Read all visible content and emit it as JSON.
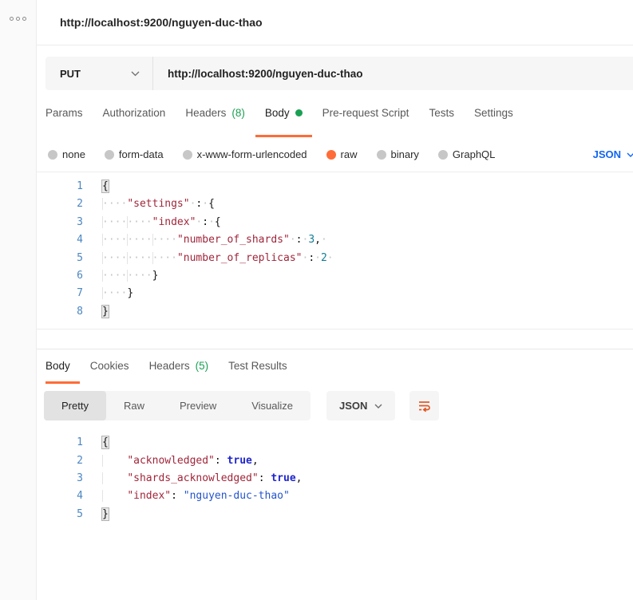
{
  "colors": {
    "accent_orange": "#ff6c37",
    "success_green": "#1aa053",
    "link_blue": "#1266f1",
    "key_maroon": "#a0263a",
    "number_teal": "#107d95",
    "atom_blue": "#2026cc",
    "string_blue": "#2454cc"
  },
  "tab_header": {
    "title": "http://localhost:9200/nguyen-duc-thao"
  },
  "request": {
    "method": "PUT",
    "url": "http://localhost:9200/nguyen-duc-thao",
    "tabs": [
      {
        "label": "Params"
      },
      {
        "label": "Authorization"
      },
      {
        "label": "Headers",
        "count": "(8)"
      },
      {
        "label": "Body",
        "active": true,
        "dot": true
      },
      {
        "label": "Pre-request Script"
      },
      {
        "label": "Tests"
      },
      {
        "label": "Settings"
      }
    ],
    "body_types": [
      {
        "label": "none"
      },
      {
        "label": "form-data"
      },
      {
        "label": "x-www-form-urlencoded"
      },
      {
        "label": "raw",
        "selected": true
      },
      {
        "label": "binary"
      },
      {
        "label": "GraphQL"
      }
    ],
    "language": "JSON",
    "editor": {
      "show_whitespace": true,
      "lines": [
        {
          "n": "1",
          "seg": [
            [
              "pun hl",
              "{"
            ]
          ]
        },
        {
          "n": "2",
          "seg": [
            [
              "ind",
              "    "
            ],
            [
              "key",
              "\"settings\""
            ],
            [
              "ws",
              " "
            ],
            [
              "pun",
              ":"
            ],
            [
              "ws",
              " "
            ],
            [
              "pun",
              "{"
            ]
          ]
        },
        {
          "n": "3",
          "seg": [
            [
              "ind",
              "        "
            ],
            [
              "key",
              "\"index\""
            ],
            [
              "ws",
              " "
            ],
            [
              "pun",
              ":"
            ],
            [
              "ws",
              " "
            ],
            [
              "pun",
              "{"
            ]
          ]
        },
        {
          "n": "4",
          "seg": [
            [
              "ind",
              "            "
            ],
            [
              "key",
              "\"number_of_shards\""
            ],
            [
              "ws",
              " "
            ],
            [
              "pun",
              ":"
            ],
            [
              "ws",
              " "
            ],
            [
              "num",
              "3"
            ],
            [
              "pun",
              ","
            ],
            [
              "ws",
              " "
            ]
          ]
        },
        {
          "n": "5",
          "seg": [
            [
              "ind",
              "            "
            ],
            [
              "key",
              "\"number_of_replicas\""
            ],
            [
              "ws",
              " "
            ],
            [
              "pun",
              ":"
            ],
            [
              "ws",
              " "
            ],
            [
              "num",
              "2"
            ],
            [
              "ws",
              " "
            ]
          ]
        },
        {
          "n": "6",
          "seg": [
            [
              "ind",
              "        "
            ],
            [
              "pun",
              "}"
            ]
          ]
        },
        {
          "n": "7",
          "seg": [
            [
              "ind",
              "    "
            ],
            [
              "pun",
              "}"
            ]
          ]
        },
        {
          "n": "8",
          "seg": [
            [
              "pun hl",
              "}"
            ]
          ]
        }
      ]
    }
  },
  "response": {
    "tabs": [
      {
        "label": "Body",
        "active": true
      },
      {
        "label": "Cookies"
      },
      {
        "label": "Headers",
        "count": "(5)"
      },
      {
        "label": "Test Results"
      }
    ],
    "views": [
      {
        "label": "Pretty",
        "active": true
      },
      {
        "label": "Raw"
      },
      {
        "label": "Preview"
      },
      {
        "label": "Visualize"
      }
    ],
    "language": "JSON",
    "editor": {
      "show_whitespace": false,
      "lines": [
        {
          "n": "1",
          "seg": [
            [
              "pun hl",
              "{"
            ]
          ]
        },
        {
          "n": "2",
          "seg": [
            [
              "ind",
              "    "
            ],
            [
              "key",
              "\"acknowledged\""
            ],
            [
              "pun",
              ":"
            ],
            [
              "ws",
              " "
            ],
            [
              "atom",
              "true"
            ],
            [
              "pun",
              ","
            ]
          ]
        },
        {
          "n": "3",
          "seg": [
            [
              "ind",
              "    "
            ],
            [
              "key",
              "\"shards_acknowledged\""
            ],
            [
              "pun",
              ":"
            ],
            [
              "ws",
              " "
            ],
            [
              "atom",
              "true"
            ],
            [
              "pun",
              ","
            ]
          ]
        },
        {
          "n": "4",
          "seg": [
            [
              "ind",
              "    "
            ],
            [
              "key",
              "\"index\""
            ],
            [
              "pun",
              ":"
            ],
            [
              "ws",
              " "
            ],
            [
              "str",
              "\"nguyen-duc-thao\""
            ]
          ]
        },
        {
          "n": "5",
          "seg": [
            [
              "pun hl",
              "}"
            ]
          ]
        }
      ]
    }
  }
}
